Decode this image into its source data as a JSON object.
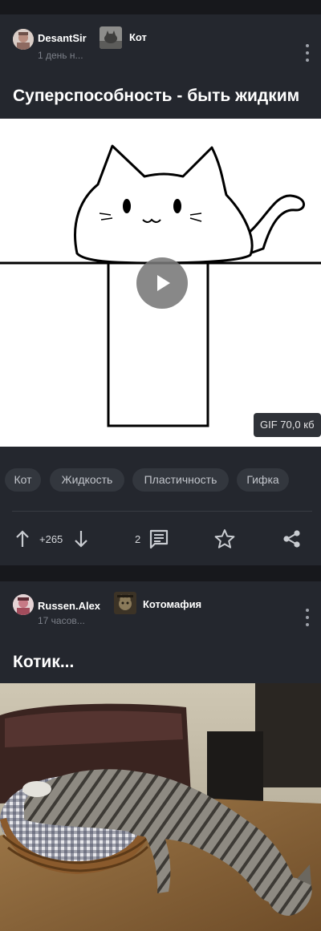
{
  "posts": [
    {
      "author": "DesantSir",
      "time": "1 день н...",
      "community": "Кот",
      "title": "Суперспособность - быть жидким",
      "media": {
        "type": "gif",
        "badge": "GIF 70,0 кб",
        "icon": "play-icon"
      },
      "tags": [
        "Кот",
        "Жидкость",
        "Пластичность",
        "Гифка"
      ],
      "rating": "+265",
      "comments": "2",
      "icons": [
        "arrow-up-icon",
        "arrow-down-icon",
        "comment-icon",
        "star-icon",
        "share-icon",
        "more-icon"
      ]
    },
    {
      "author": "Russen.Alex",
      "time": "17 часов...",
      "community": "Котомафия",
      "title": "Котик...",
      "media": {
        "type": "photo"
      }
    }
  ],
  "colors": {
    "background": "#17181c",
    "card": "#24272e",
    "tag": "#33373e",
    "text": "#ffffff",
    "muted": "#7c8089"
  }
}
